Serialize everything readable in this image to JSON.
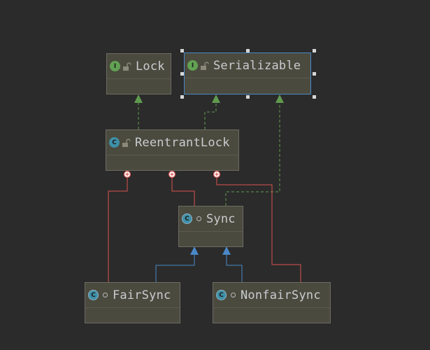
{
  "nodes": {
    "lock": {
      "name": "Lock",
      "kind_letter": "I"
    },
    "serializable": {
      "name": "Serializable",
      "kind_letter": "I"
    },
    "reentrant_lock": {
      "name": "ReentrantLock",
      "kind_letter": "C"
    },
    "sync": {
      "name": "Sync",
      "kind_letter": "C"
    },
    "fair_sync": {
      "name": "FairSync",
      "kind_letter": "C"
    },
    "nonfair_sync": {
      "name": "NonfairSync",
      "kind_letter": "C"
    }
  },
  "colors": {
    "background": "#2b2b2b",
    "node_fill": "#4b4a3e",
    "interface_icon": "#62a253",
    "class_icon": "#3f90a8",
    "implements_edge": "#5f9b4e",
    "extends_edge": "#4a88c7",
    "inner_class_edge": "#d9534f",
    "selection": "#4a88c7"
  },
  "edge_types": [
    "implements",
    "extends",
    "inner-class"
  ]
}
